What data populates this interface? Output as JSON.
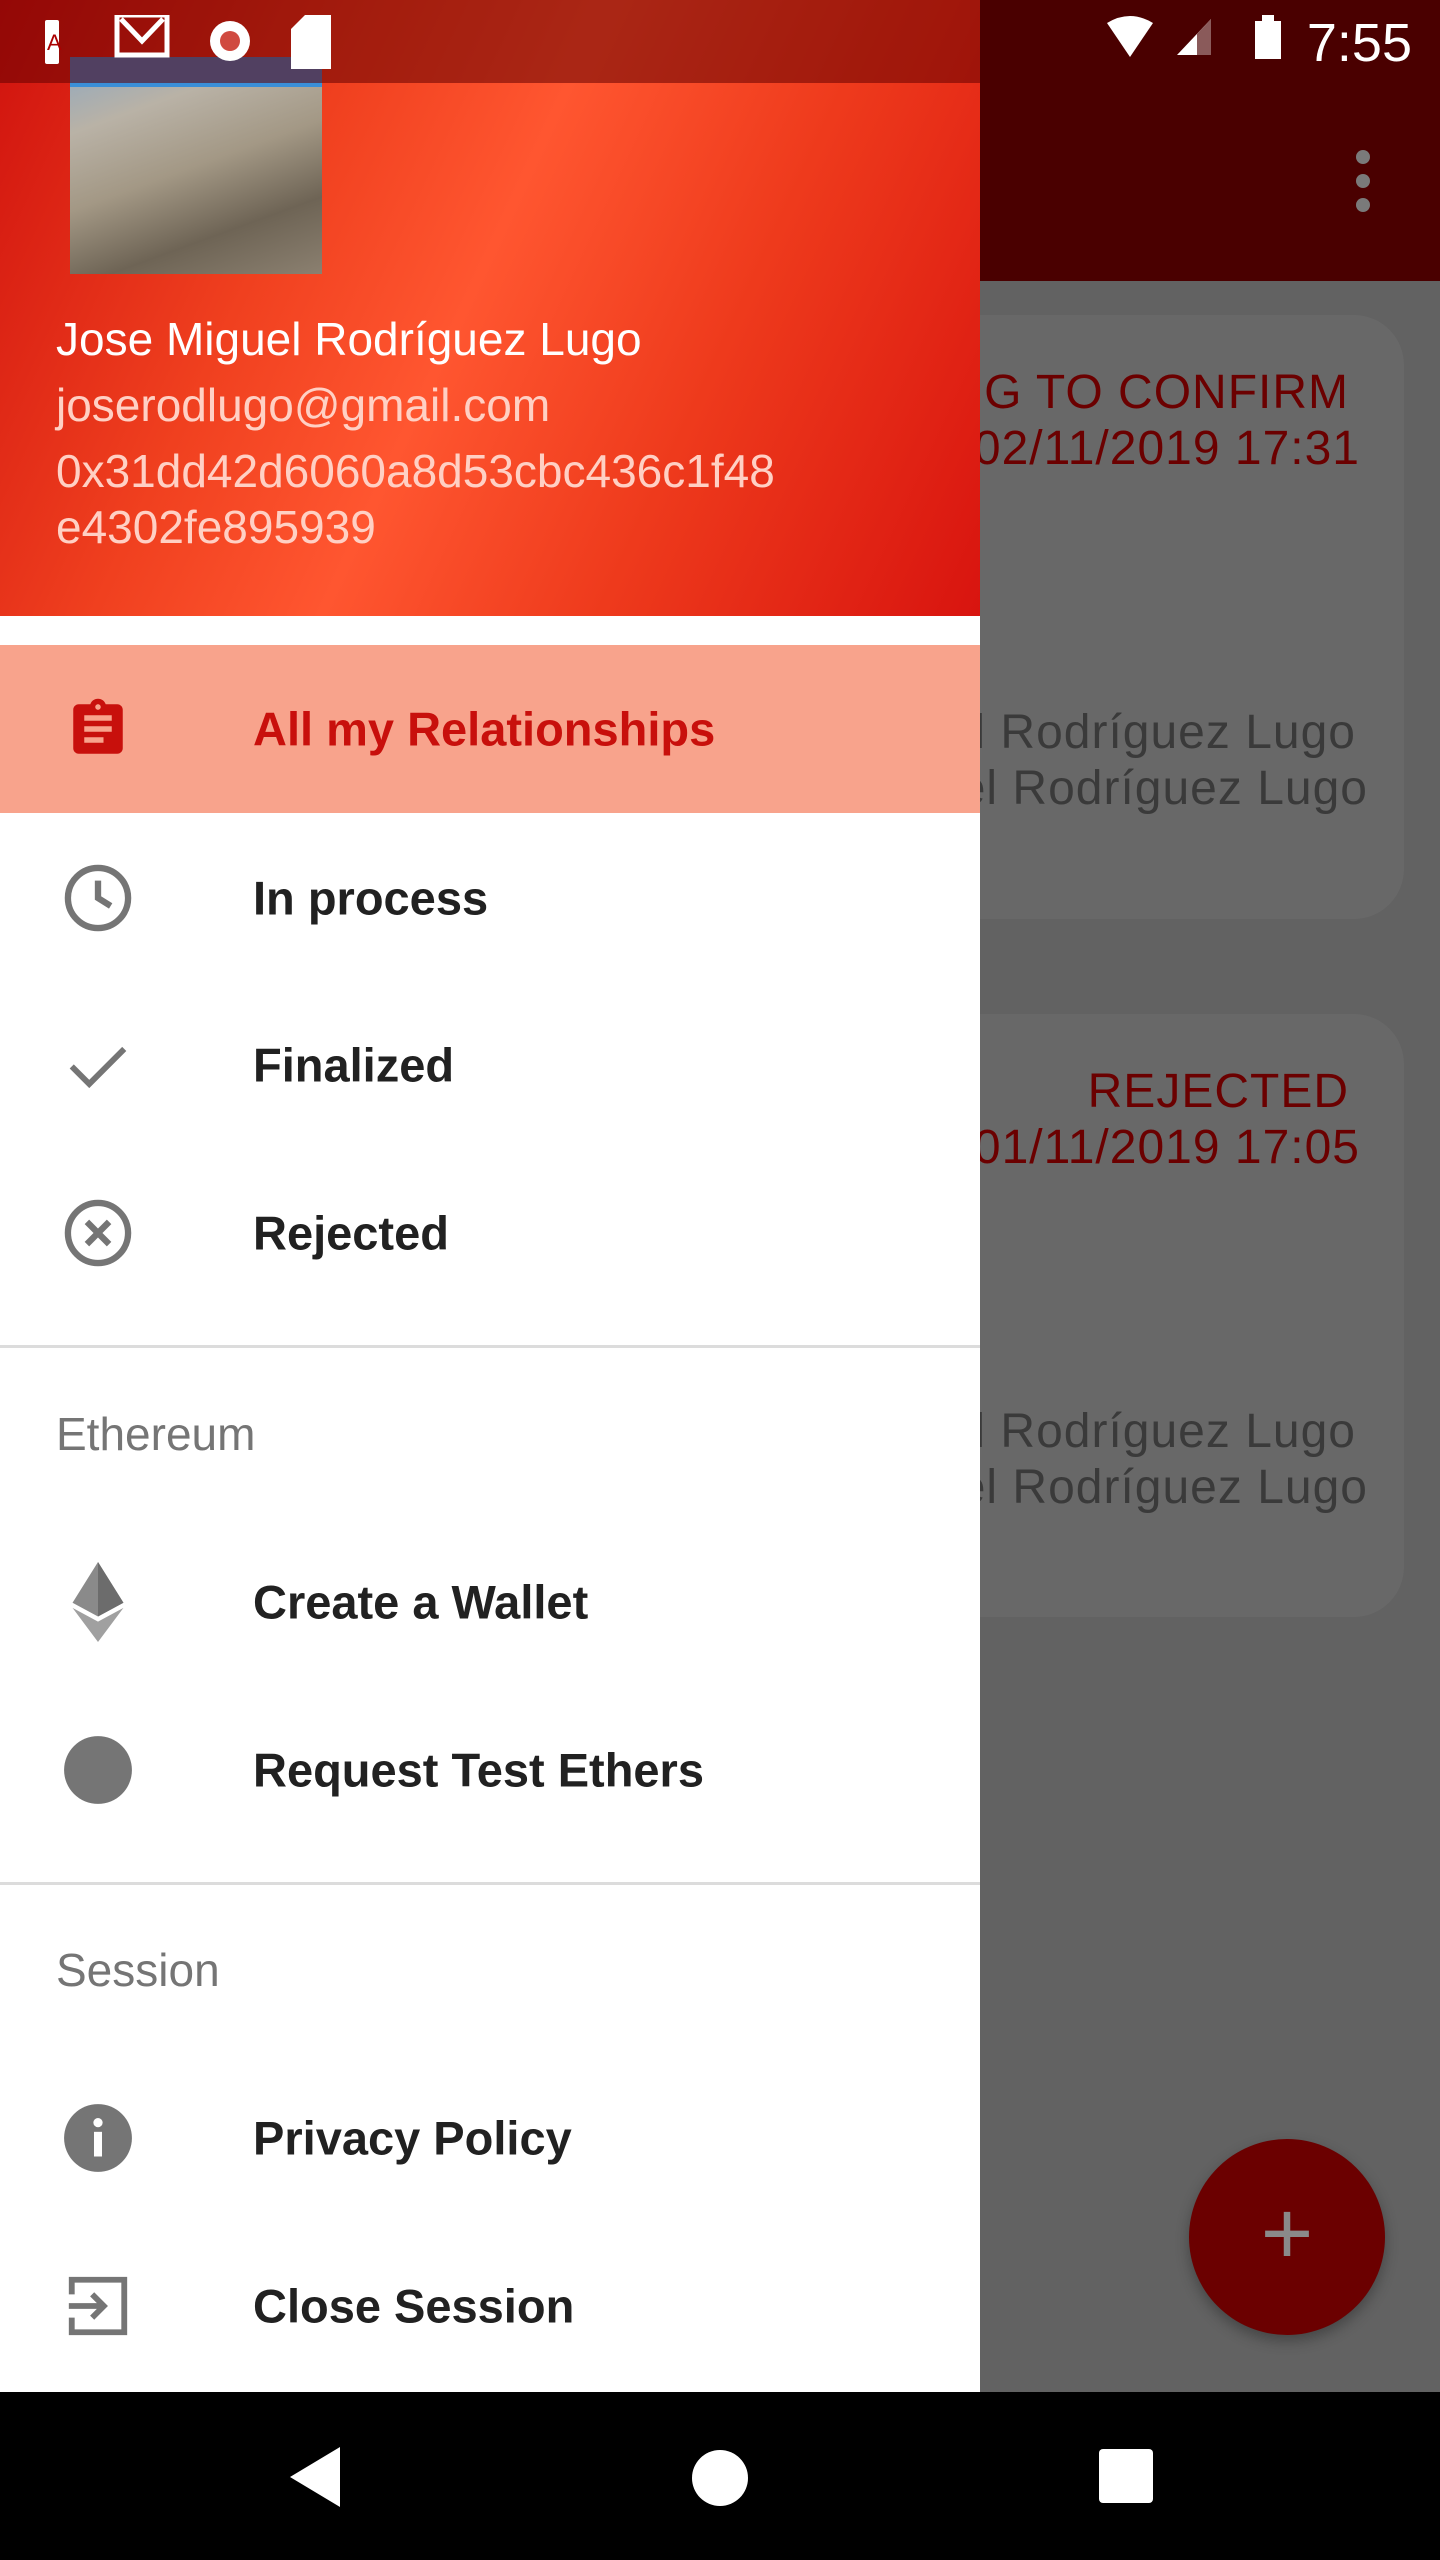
{
  "status_bar": {
    "time": "7:55",
    "notification_icons": [
      "adobe-acrobat-icon",
      "gmail-icon",
      "record-icon",
      "sd-card-icon"
    ],
    "system_icons": [
      "wifi-icon",
      "signal-icon",
      "battery-icon"
    ]
  },
  "background": {
    "cards": [
      {
        "status": "NG TO CONFIRM",
        "date": "02/11/2019 17:31",
        "name1": "el Rodríguez Lugo",
        "name2": "el Rodríguez Lugo"
      },
      {
        "status": "REJECTED",
        "date": "01/11/2019 17:05",
        "name1": "el Rodríguez Lugo",
        "name2": "el Rodríguez Lugo"
      }
    ],
    "fab_icon": "plus-icon"
  },
  "drawer": {
    "header": {
      "name": "Jose Miguel Rodríguez Lugo",
      "email": "joserodlugo@gmail.com",
      "address_line1": "0x31dd42d6060a8d53cbc436c1f48",
      "address_line2": "e4302fe895939"
    },
    "items": [
      {
        "label": "All my Relationships",
        "icon": "clipboard-icon",
        "selected": true
      },
      {
        "label": "In process",
        "icon": "clock-icon"
      },
      {
        "label": "Finalized",
        "icon": "check-icon"
      },
      {
        "label": "Rejected",
        "icon": "cancel-circle-icon"
      }
    ],
    "ethereum": {
      "title": "Ethereum",
      "items": [
        {
          "label": "Create a Wallet",
          "icon": "ethereum-icon"
        },
        {
          "label": "Request Test Ethers",
          "icon": "circle-icon"
        }
      ]
    },
    "session": {
      "title": "Session",
      "items": [
        {
          "label": "Privacy Policy",
          "icon": "info-icon"
        },
        {
          "label": "Close Session",
          "icon": "exit-icon"
        }
      ]
    }
  },
  "colors": {
    "accent": "#c8100c",
    "selected_bg": "#f8a38c",
    "appbar": "#4a0000"
  }
}
